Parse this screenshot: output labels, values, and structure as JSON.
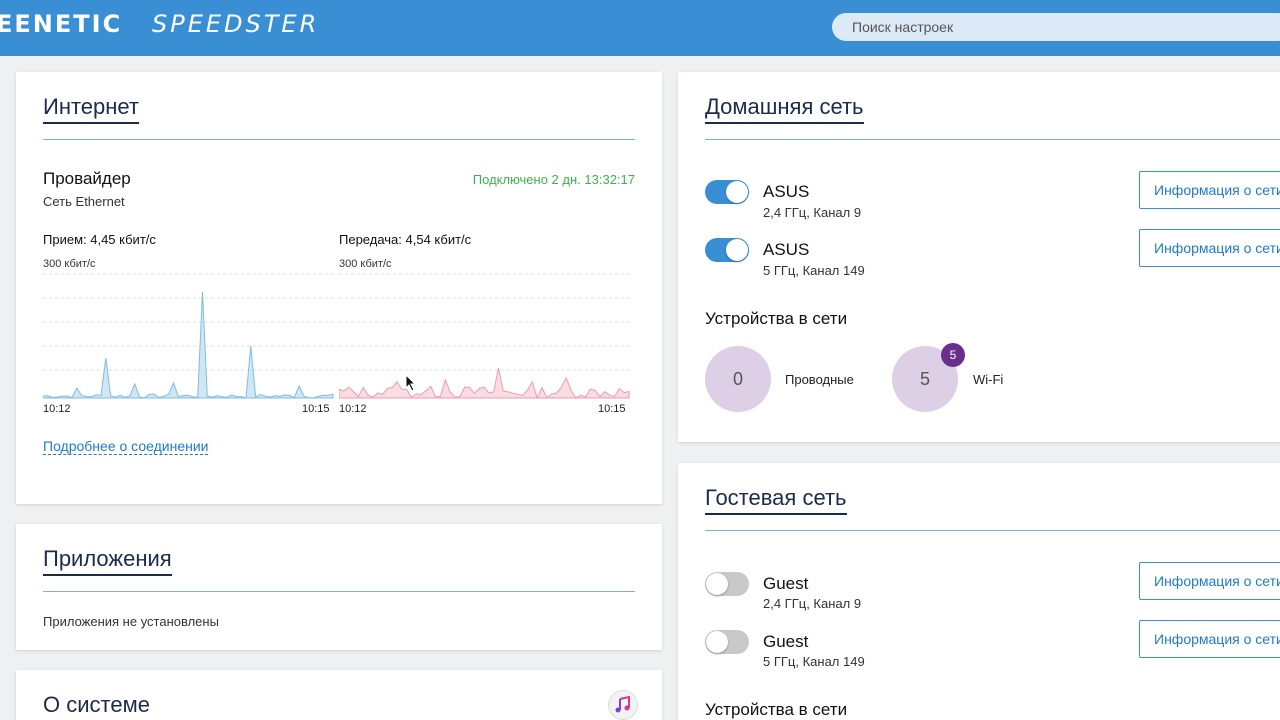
{
  "header": {
    "brand_bold": "EENETIC",
    "brand_model": "SPEEDSTER",
    "search_placeholder": "Поиск настроек"
  },
  "internet": {
    "title": "Интернет",
    "provider_label": "Провайдер",
    "provider_type": "Сеть Ethernet",
    "status": "Подключено 2 дн. 13:32:17",
    "rx_label": "Прием: 4,45 кбит/с",
    "tx_label": "Передача: 4,54 кбит/с",
    "rx_scale": "300 кбит/с",
    "tx_scale": "300 кбит/с",
    "rx_time_start": "10:12",
    "rx_time_end": "10:15",
    "tx_time_start": "10:12",
    "tx_time_end": "10:15",
    "details_link": "Подробнее о соединении",
    "rx_color": "#a9d3ea",
    "tx_color": "#f2b6c3"
  },
  "apps": {
    "title": "Приложения",
    "empty_text": "Приложения не установлены"
  },
  "system": {
    "title": "О системе",
    "icon": "music-note-icon"
  },
  "home": {
    "title": "Домашняя сеть",
    "networks": [
      {
        "name": "ASUS",
        "details": "2,4 ГГц, Канал 9",
        "enabled": true,
        "button": "Информация о сети"
      },
      {
        "name": "ASUS",
        "details": "5 ГГц, Канал 149",
        "enabled": true,
        "button": "Информация о сети"
      }
    ],
    "devices_title": "Устройства в сети",
    "wired_count": "0",
    "wired_label": "Проводные",
    "wifi_count": "5",
    "wifi_badge": "5",
    "wifi_label": "Wi-Fi"
  },
  "guest": {
    "title": "Гостевая сеть",
    "networks": [
      {
        "name": "Guest",
        "details": "2,4 ГГц, Канал 9",
        "enabled": false,
        "button": "Информация о сети"
      },
      {
        "name": "Guest",
        "details": "5 ГГц, Канал 149",
        "enabled": false,
        "button": "Информация о сети"
      }
    ],
    "devices_title": "Устройства в сети"
  },
  "colors": {
    "accent": "#3a8fd4",
    "connected": "#3ab54a",
    "badge": "#6a2f8a"
  }
}
